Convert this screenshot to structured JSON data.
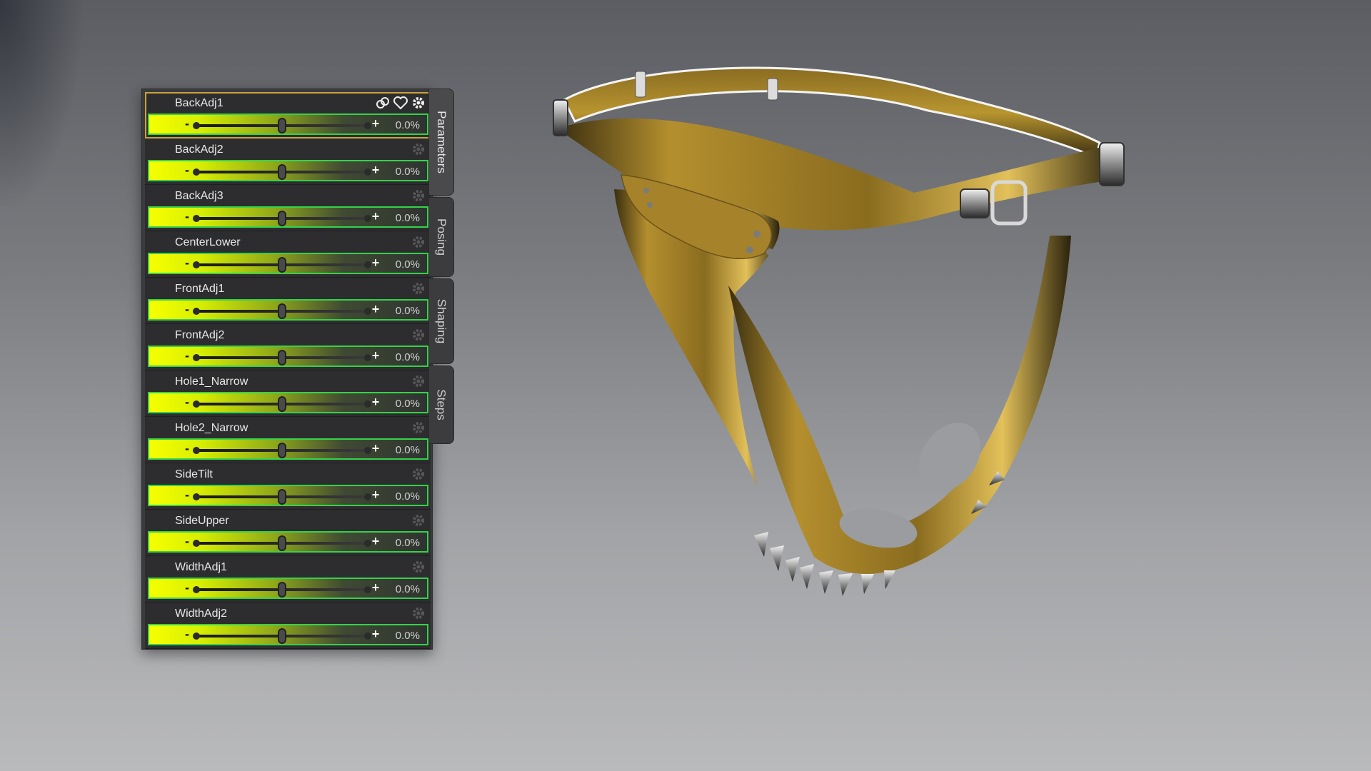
{
  "panel": {
    "tabs": [
      {
        "label": "Parameters",
        "active": true
      },
      {
        "label": "Posing",
        "active": false
      },
      {
        "label": "Shaping",
        "active": false
      },
      {
        "label": "Steps",
        "active": false
      }
    ],
    "rows": [
      {
        "label": "BackAdj1",
        "value": "0.0%",
        "selected": true
      },
      {
        "label": "BackAdj2",
        "value": "0.0%"
      },
      {
        "label": "BackAdj3",
        "value": "0.0%"
      },
      {
        "label": "CenterLower",
        "value": "0.0%"
      },
      {
        "label": "FrontAdj1",
        "value": "0.0%"
      },
      {
        "label": "FrontAdj2",
        "value": "0.0%"
      },
      {
        "label": "Hole1_Narrow",
        "value": "0.0%"
      },
      {
        "label": "Hole2_Narrow",
        "value": "0.0%"
      },
      {
        "label": "SideTilt",
        "value": "0.0%"
      },
      {
        "label": "SideUpper",
        "value": "0.0%"
      },
      {
        "label": "WidthAdj1",
        "value": "0.0%"
      },
      {
        "label": "WidthAdj2",
        "value": "0.0%"
      }
    ],
    "slider_minus": "-",
    "slider_plus": "+",
    "slider_level": 0.5
  },
  "colors": {
    "accent_selected": "#c9a23c",
    "slider_border": "#35d24a",
    "slider_fill": "#f7ff00",
    "gold": "#b48f2e"
  },
  "icons": [
    "link-icon",
    "heart-icon",
    "gear-icon"
  ]
}
